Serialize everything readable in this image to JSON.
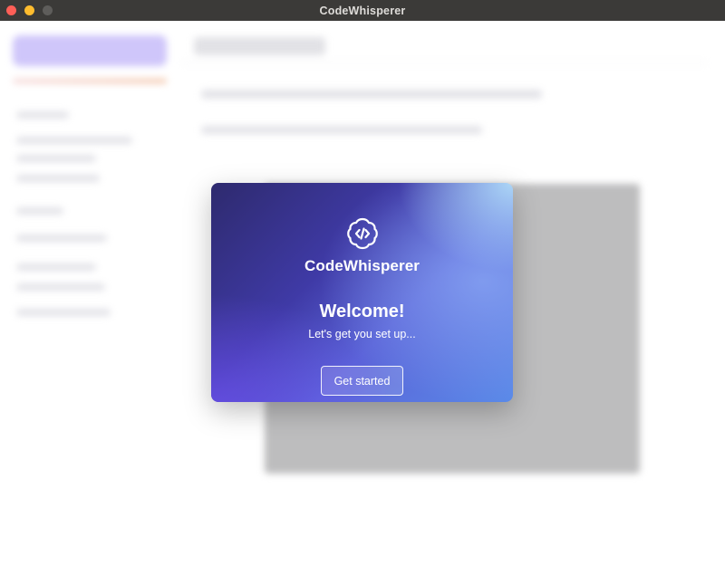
{
  "window": {
    "title": "CodeWhisperer"
  },
  "dialog": {
    "brand": "CodeWhisperer",
    "heading": "Welcome!",
    "subtitle": "Let's get you set up...",
    "button_label": "Get started",
    "logo_icon": "brain-code-icon"
  },
  "colors": {
    "titlebar": "#3b3a38",
    "gradient_start": "#2e2a6e",
    "gradient_end": "#5a8ae8"
  }
}
